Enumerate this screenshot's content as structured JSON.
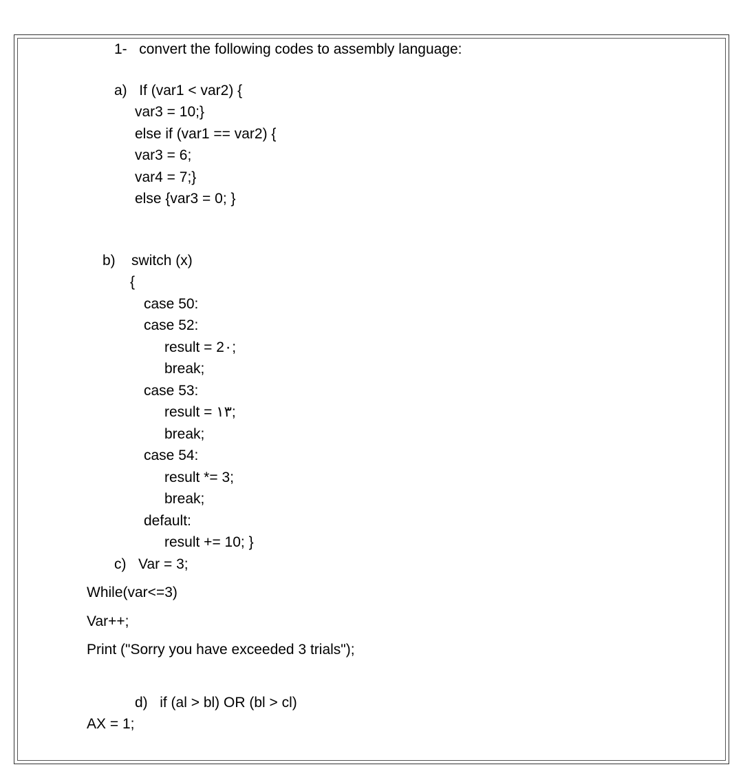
{
  "question": {
    "number": "1-",
    "prompt": "convert the following codes to assembly language:"
  },
  "parts": {
    "a": {
      "label": "a)",
      "lines": [
        "If (var1 < var2) {",
        "var3 = 10;}",
        "else if (var1 == var2) {",
        "var3 = 6;",
        "var4 = 7;}",
        "else {var3 = 0; }"
      ]
    },
    "b": {
      "label": "b)",
      "header": "switch (x)",
      "brace": "{",
      "lines": [
        {
          "class": "case-indent",
          "text": "case 50:"
        },
        {
          "class": "case-indent",
          "text": "case 52:"
        },
        {
          "class": "case-body",
          "text": "result = 2٠;"
        },
        {
          "class": "case-body",
          "text": "break;"
        },
        {
          "class": "case-indent",
          "text": "case 53:"
        },
        {
          "class": "case-body",
          "text": "result = ١٣;"
        },
        {
          "class": "case-body",
          "text": "break;"
        },
        {
          "class": "case-indent",
          "text": "case 54:"
        },
        {
          "class": "case-body",
          "text": "result *= 3;"
        },
        {
          "class": "case-body",
          "text": "break;"
        },
        {
          "class": "case-indent",
          "text": "default:"
        },
        {
          "class": "case-body",
          "text": "result += 10; }"
        }
      ]
    },
    "c": {
      "label": "c)",
      "header": "Var = 3;",
      "lines": [
        "While(var<=3)",
        "Var++;",
        "Print (\"Sorry you have exceeded 3 trials\");"
      ]
    },
    "d": {
      "label": "d)",
      "header": "if (al > bl) OR (bl > cl)",
      "line": "AX = 1;"
    }
  }
}
